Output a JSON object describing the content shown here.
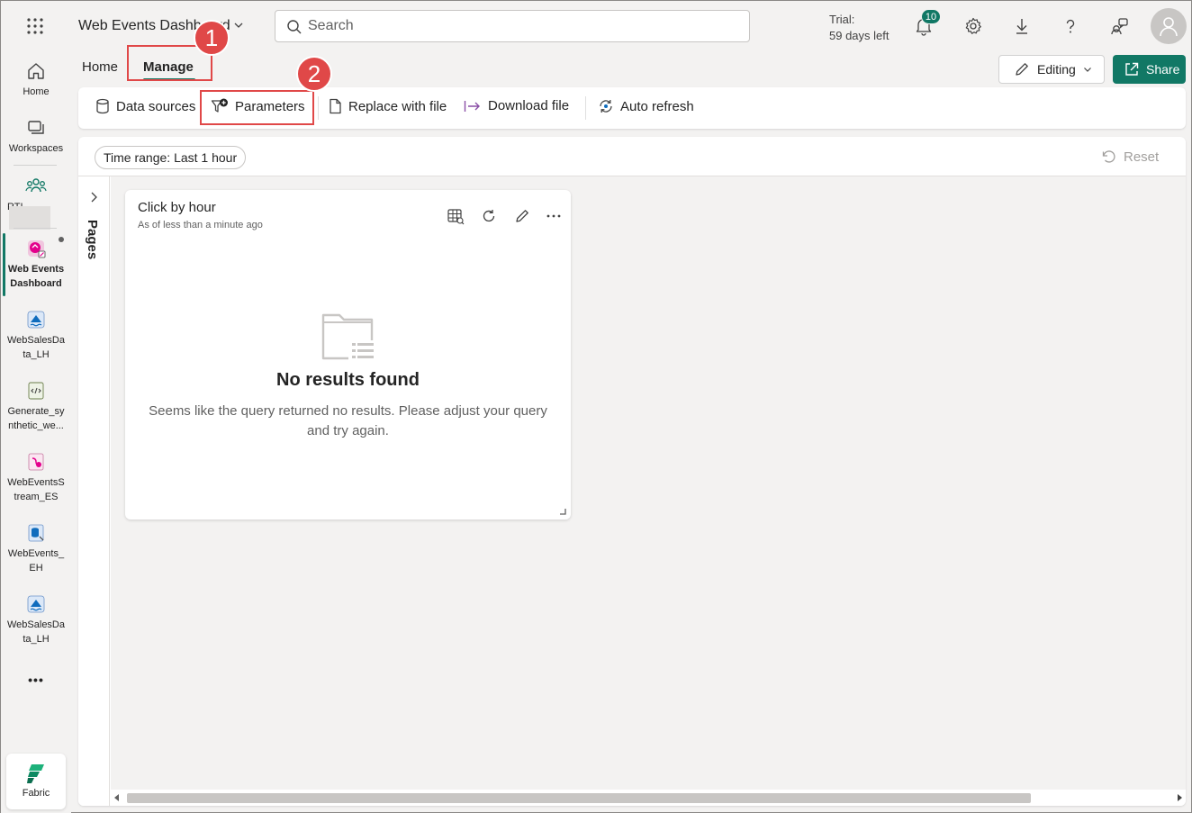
{
  "topbar": {
    "app_title": "Web Events Dashboard",
    "search_placeholder": "Search",
    "trial_line1": "Trial:",
    "trial_line2": "59 days left",
    "notification_count": "10"
  },
  "rail": {
    "items": [
      {
        "label": "Home"
      },
      {
        "label": "Workspaces"
      },
      {
        "label": "RTI_"
      },
      {
        "label_line1": "Web Events",
        "label_line2": "Dashboard"
      },
      {
        "label_line1": "WebSalesDa",
        "label_line2": "ta_LH"
      },
      {
        "label_line1": "Generate_sy",
        "label_line2": "nthetic_we..."
      },
      {
        "label_line1": "WebEventsS",
        "label_line2": "tream_ES"
      },
      {
        "label_line1": "WebEvents_",
        "label_line2": "EH"
      },
      {
        "label_line1": "WebSalesDa",
        "label_line2": "ta_LH"
      }
    ],
    "more": "•••",
    "fabric_label": "Fabric"
  },
  "tabs": {
    "home": "Home",
    "manage": "Manage"
  },
  "header_actions": {
    "editing": "Editing",
    "share": "Share"
  },
  "ribbon": {
    "data_sources": "Data sources",
    "parameters": "Parameters",
    "replace_with_file": "Replace with file",
    "download_file": "Download file",
    "auto_refresh": "Auto refresh"
  },
  "filterbar": {
    "time_range": "Time range: Last 1 hour",
    "reset": "Reset"
  },
  "pages_label": "Pages",
  "tile": {
    "title": "Click by hour",
    "subtitle": "As of less than a minute ago",
    "empty_title": "No results found",
    "empty_message": "Seems like the query returned no results. Please adjust your query and try again."
  },
  "annotations": [
    "1",
    "2"
  ],
  "colors": {
    "accent": "#117865",
    "annotation": "#e04848"
  }
}
